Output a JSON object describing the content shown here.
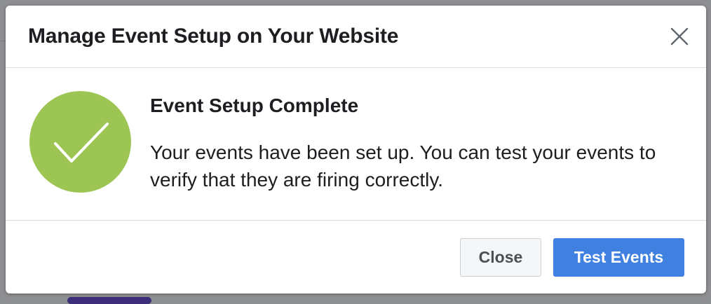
{
  "dialog": {
    "title": "Manage Event Setup on Your Website",
    "close_icon": "close-icon",
    "body": {
      "icon": "checkmark-circle-icon",
      "icon_color": "#9dc553",
      "heading": "Event Setup Complete",
      "message": "Your events have been set up. You can test your events to verify that they are firing correctly."
    },
    "footer": {
      "close_label": "Close",
      "primary_label": "Test Events",
      "primary_color": "#4080e0"
    }
  }
}
